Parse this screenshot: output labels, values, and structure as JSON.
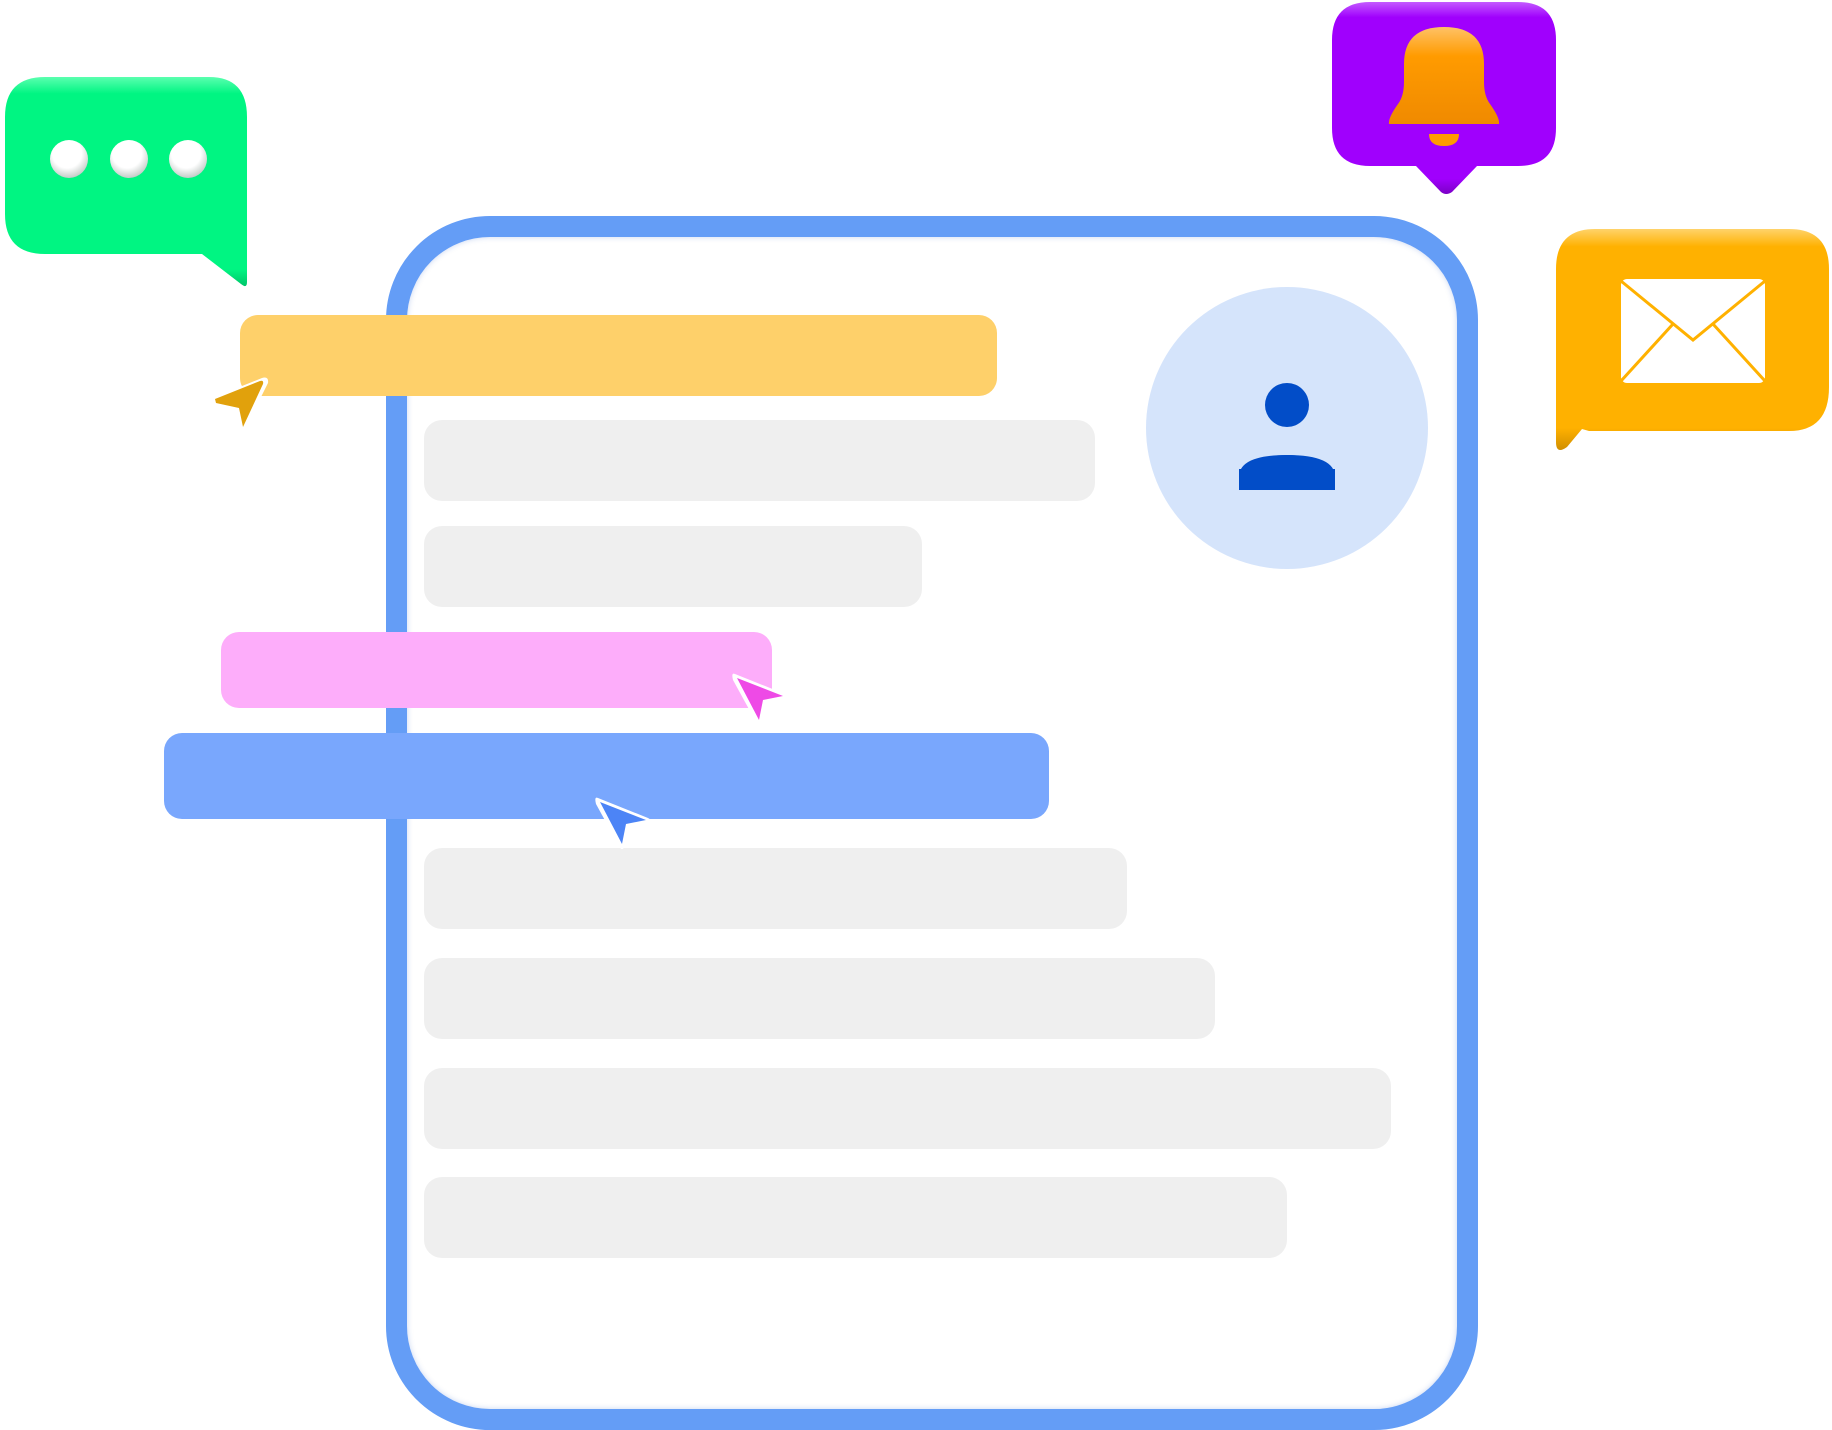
{
  "colors": {
    "frame_border": "#649DF6",
    "frame_bg": "#FFFFFF",
    "placeholder_bar": "#EFEFEF",
    "avatar_bg": "#D5E4FB",
    "avatar_icon": "#024DC8",
    "bar_yellow": "#FED06A",
    "bar_pink": "#FDADFA",
    "bar_blue": "#79A7FD",
    "cursor_yellow": "#E1A10C",
    "cursor_pink": "#EE4AE6",
    "cursor_blue": "#4C84F6",
    "chat_bubble": "#00F582",
    "bell_bubble": "#A000FD",
    "bell": "#FF9B00",
    "mail_bubble": "#FFB100"
  },
  "icons": {
    "chat": "chat-bubble-icon",
    "bell": "notification-bell-icon",
    "mail": "mail-envelope-icon",
    "avatar": "user-avatar-icon",
    "cursor": "mouse-pointer-icon"
  }
}
